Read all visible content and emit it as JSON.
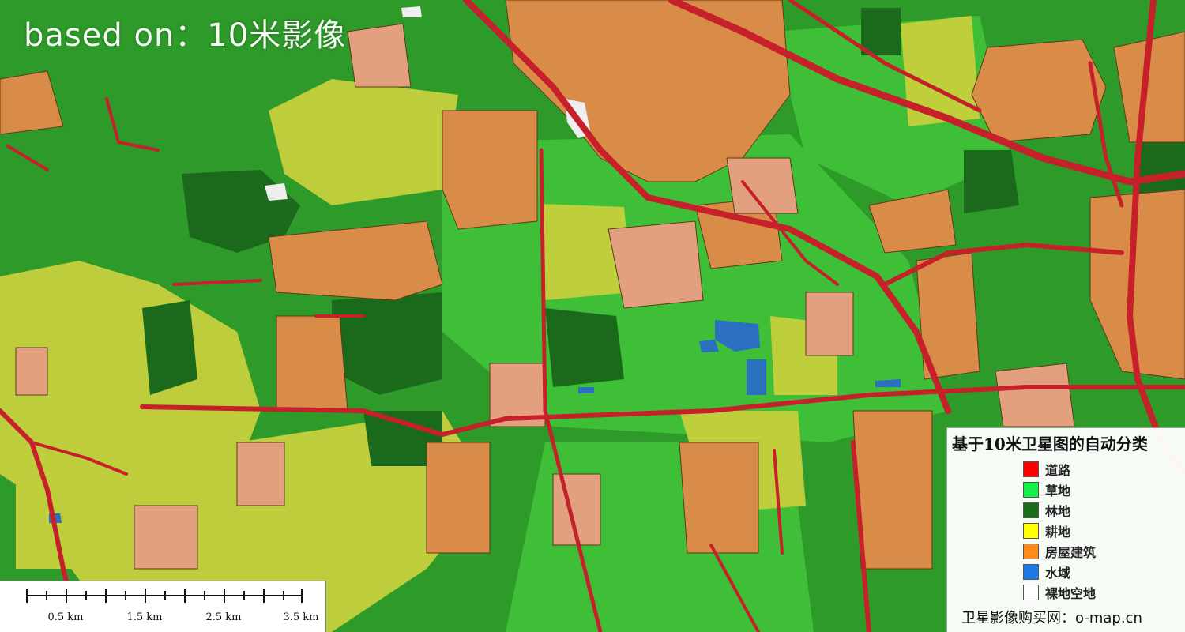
{
  "map": {
    "title_overlay": "based on：10米影像",
    "colors": {
      "forest_bg": "#2e9a2a",
      "grass": "#3fc23a",
      "dense_forest": "#1d6e1d",
      "farmland": "#c9d43f",
      "building": "#dd9050",
      "building_light": "#e2a07a",
      "road": "#c8202c",
      "water": "#1f6fc4",
      "bare": "#f2f2f2"
    }
  },
  "legend": {
    "title": "基于10米卫星图的自动分类",
    "items": [
      {
        "label": "道路",
        "color": "#ff0000"
      },
      {
        "label": "草地",
        "color": "#14f04a"
      },
      {
        "label": "林地",
        "color": "#1a6e1a"
      },
      {
        "label": "耕地",
        "color": "#ffff00"
      },
      {
        "label": "房屋建筑",
        "color": "#ff8c1a"
      },
      {
        "label": "水域",
        "color": "#1f78e8"
      },
      {
        "label": "裸地空地",
        "color": "#ffffff"
      }
    ],
    "footer": "卫星影像购买网：o-map.cn"
  },
  "scalebar": {
    "labels": [
      "0.5 km",
      "1.5 km",
      "2.5 km",
      "3.5 km"
    ]
  }
}
